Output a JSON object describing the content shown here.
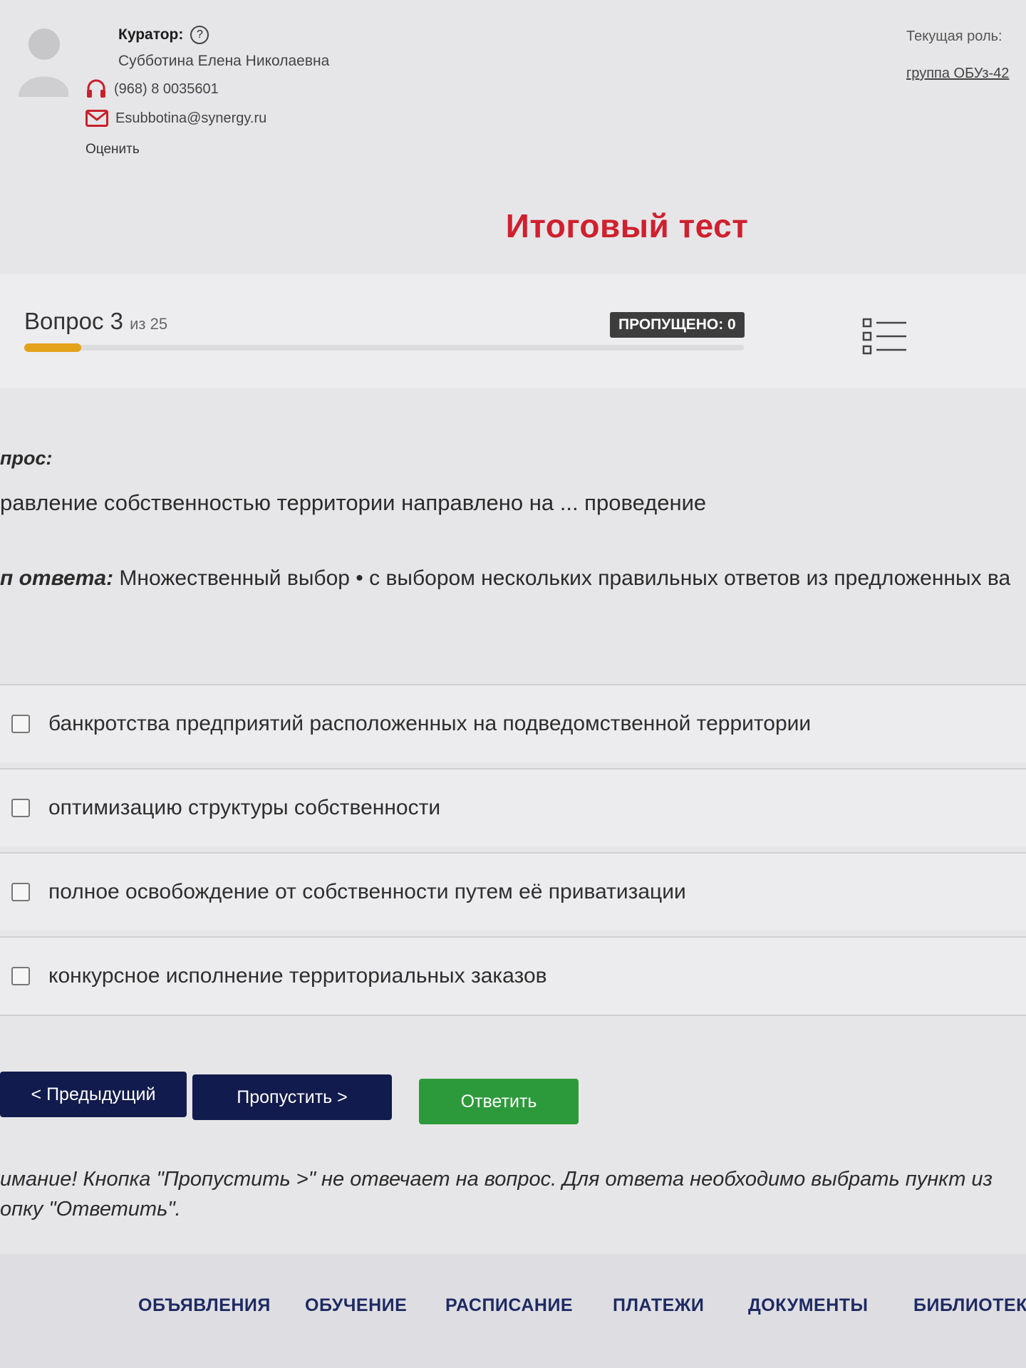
{
  "curator": {
    "title": "Куратор:",
    "help_glyph": "?",
    "name": "Субботина Елена Николаевна",
    "phone": "(968) 8 0035601",
    "email": "Esubbotina@synergy.ru",
    "rate": "Оценить"
  },
  "role": {
    "label": "Текущая роль:",
    "value": "группа ОБУз-42"
  },
  "page_title": "Итоговый тест",
  "question_header": {
    "counter": "Вопрос 3",
    "of": "из 25",
    "current": 3,
    "total": 25,
    "skipped": "ПРОПУЩЕНО: 0"
  },
  "question": {
    "label": "прос:",
    "text": "равление собственностью территории направлено на ... проведение",
    "answer_type_label": "п ответа:",
    "answer_type_value": "Множественный выбор • с выбором нескольких правильных ответов из предложенных ва"
  },
  "options": [
    {
      "text": "банкротства предприятий расположенных на подведомственной территории",
      "checked": false
    },
    {
      "text": "оптимизацию структуры собственности",
      "checked": false
    },
    {
      "text": "полное освобождение от собственности путем её приватизации",
      "checked": false
    },
    {
      "text": "конкурсное исполнение территориальных заказов",
      "checked": false
    }
  ],
  "buttons": {
    "prev": "< Предыдущий",
    "skip": "Пропустить >",
    "answer": "Ответить"
  },
  "note": {
    "line1": "имание! Кнопка \"Пропустить >\" не отвечает на вопрос. Для ответа необходимо выбрать пункт из",
    "line2": "опку \"Ответить\"."
  },
  "nav": [
    "ОБЪЯВЛЕНИЯ",
    "ОБУЧЕНИЕ",
    "РАСПИСАНИЕ",
    "ПЛАТЕЖИ",
    "ДОКУМЕНТЫ",
    "БИБЛИОТЕК"
  ],
  "colors": {
    "title_red": "#d0202e",
    "nav_blue": "#1e2a63",
    "button_navy": "#121b4d",
    "button_green": "#2c9a3a",
    "progress_orange": "#e3a21a",
    "icon_red": "#c8202c"
  },
  "icons": {
    "avatar": "user-avatar-icon",
    "help": "help-circle-icon",
    "phone": "headset-icon",
    "email": "envelope-icon",
    "question_list": "question-list-icon",
    "checkbox": "checkbox-icon"
  }
}
